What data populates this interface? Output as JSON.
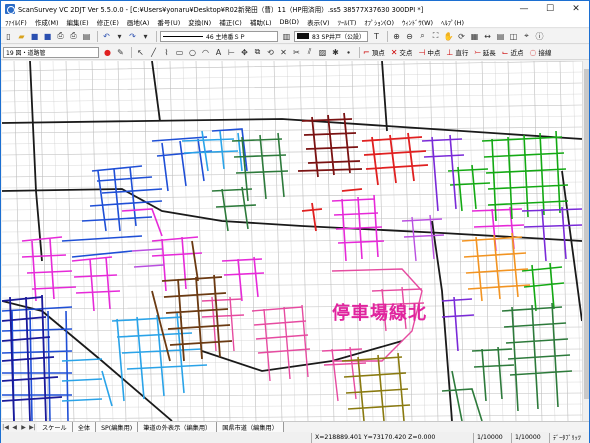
{
  "window": {
    "title": "ScanSurvey VC 2DJT  Ver 5.5.0.0 - [C:¥Users¥yonaru¥Desktop¥R02新発田（曹）11（HP用済用）.ss5  38577X37630 300DPI *]",
    "minimize": "—",
    "maximize": "☐",
    "close": "✕"
  },
  "menu": [
    "ﾌｧｲﾙ(F)",
    "作成(M)",
    "編集(E)",
    "修正(E)",
    "画地(A)",
    "番号(U)",
    "変換(N)",
    "補正(C)",
    "補助(L)",
    "DB(D)",
    "表示(V)",
    "ﾂｰﾙ(T)",
    "ｵﾌﾟｼｮﾝ(O)",
    "ｳｨﾝﾄﾞｳ(W)",
    "ﾍﾙﾌﾟ(H)"
  ],
  "toolbar1": {
    "line_style": "46 主地番ＳＰ",
    "symbol_style": "83 SP井戸（公設）"
  },
  "toolbar2": {
    "layer_combo": "19 図・道路管",
    "buttons": [
      "頂点",
      "交点",
      "中点",
      "直行",
      "延長",
      "近点",
      "接線"
    ]
  },
  "map": {
    "label": "停車場線北",
    "colors": {
      "blue": "#1f4fd6",
      "light_blue": "#2aa3e8",
      "magenta": "#e62ad8",
      "pink": "#e64ba0",
      "green": "#14a914",
      "dark_green": "#2d7a3b",
      "brown": "#6b3a12",
      "dark_red": "#7a1212",
      "red": "#e02020",
      "orange": "#f29422",
      "purple": "#7a2ad8",
      "olive": "#8a7a10",
      "navy": "#1a1a9a",
      "violet": "#b94fe0",
      "road_black": "#1a1a1a"
    }
  },
  "tabs": [
    "スケール",
    "全体",
    "SP(編集用)",
    "筆道の外表示（編集用）",
    "国県市道（編集用）"
  ],
  "status": {
    "coords": "X=218889.401 Y=73170.420 Z=0.000",
    "scale1": "1/10000",
    "scale2": "1/10000",
    "mode": "ﾃﾞｰﾀﾌﾞﾘｯﾂ"
  }
}
